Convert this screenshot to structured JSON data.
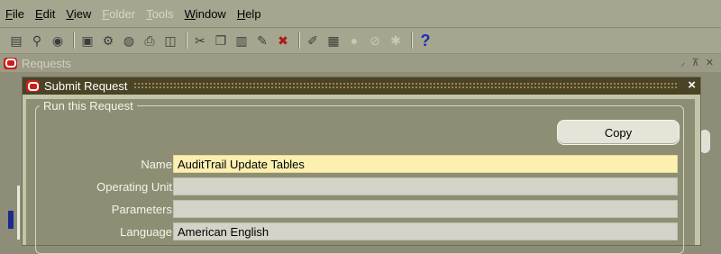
{
  "menubar": {
    "items": [
      {
        "label": "File",
        "mnemonic": "F",
        "rest": "ile",
        "enabled": true
      },
      {
        "label": "Edit",
        "mnemonic": "E",
        "rest": "dit",
        "enabled": true
      },
      {
        "label": "View",
        "mnemonic": "V",
        "rest": "iew",
        "enabled": true
      },
      {
        "label": "Folder",
        "mnemonic": "F",
        "rest": "older",
        "enabled": false
      },
      {
        "label": "Tools",
        "mnemonic": "T",
        "rest": "ools",
        "enabled": false
      },
      {
        "label": "Window",
        "mnemonic": "W",
        "rest": "indow",
        "enabled": true
      },
      {
        "label": "Help",
        "mnemonic": "H",
        "rest": "elp",
        "enabled": true
      }
    ]
  },
  "toolbar": {
    "icons": [
      "new-icon",
      "find-icon",
      "navigator-icon",
      "save-icon",
      "next-step-icon",
      "switch-responsibility-icon",
      "print-icon",
      "close-form-icon",
      "cut-icon",
      "copy-icon",
      "paste-icon",
      "clear-record-icon",
      "delete-record-icon",
      "edit-field-icon",
      "zoom-icon",
      "translations-icon",
      "attachments-icon",
      "folder-tools-icon",
      "help-icon"
    ],
    "help_glyph": "?"
  },
  "background_window": {
    "title": "Requests"
  },
  "dialog": {
    "title": "Submit Request",
    "close_glyph": "×",
    "group_legend": "Run this Request",
    "copy_label": "Copy",
    "fields": {
      "name": {
        "label": "Name",
        "value": "AuditTrail Update Tables"
      },
      "operating_unit": {
        "label": "Operating Unit",
        "value": ""
      },
      "parameters": {
        "label": "Parameters",
        "value": ""
      },
      "language": {
        "label": "Language",
        "value": "American English"
      }
    }
  }
}
